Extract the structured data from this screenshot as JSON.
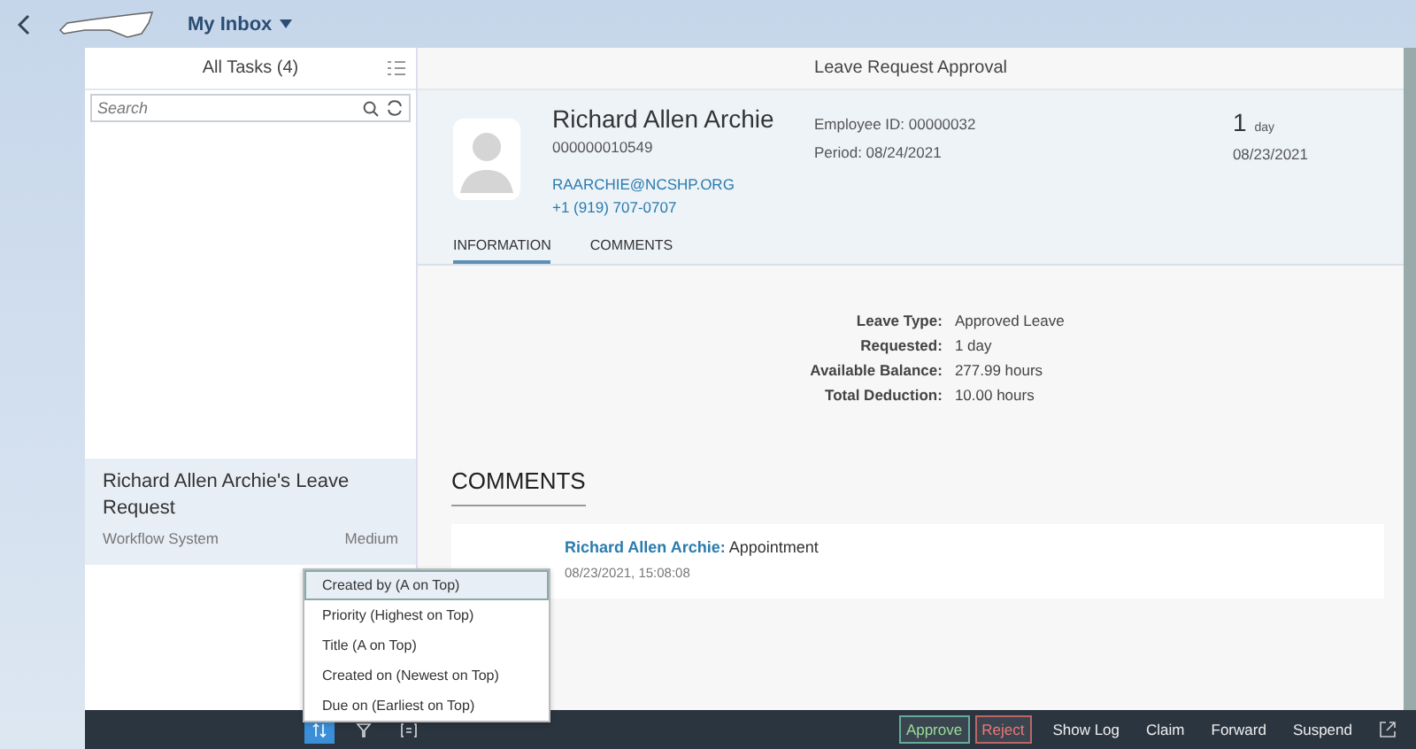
{
  "shell": {
    "title": "My Inbox"
  },
  "master": {
    "title": "All Tasks (4)",
    "search": {
      "placeholder": "Search"
    },
    "tasks": [
      {
        "title": "Richard Allen Archie's Leave Request",
        "source": "Workflow System",
        "priority": "Medium",
        "selected": true
      }
    ]
  },
  "detail": {
    "title": "Leave Request Approval",
    "name": "Richard Allen Archie",
    "number": "000000010549",
    "email": "RAARCHIE@NCSHP.ORG",
    "phone": "+1 (919) 707-0707",
    "employee_id": "Employee ID: 00000032",
    "period": "Period: 08/24/2021",
    "duration": "1",
    "duration_unit": "day",
    "date": "08/23/2021",
    "tabs": [
      {
        "label": "INFORMATION",
        "selected": true
      },
      {
        "label": "COMMENTS",
        "selected": false
      }
    ],
    "fields": [
      {
        "label": "Leave Type:",
        "value": "Approved Leave"
      },
      {
        "label": "Requested:",
        "value": "1 day"
      },
      {
        "label": "Available Balance:",
        "value": "277.99 hours"
      },
      {
        "label": "Total Deduction:",
        "value": "10.00 hours"
      }
    ],
    "comments_heading": "COMMENTS",
    "comments": [
      {
        "author": "Richard Allen Archie:",
        "text": "Appointment",
        "time": "08/23/2021, 15:08:08"
      }
    ]
  },
  "sort_menu": [
    {
      "label": "Created by (A on Top)",
      "selected": true
    },
    {
      "label": "Priority (Highest on Top)",
      "selected": false
    },
    {
      "label": "Title (A on Top)",
      "selected": false
    },
    {
      "label": "Created on (Newest on Top)",
      "selected": false
    },
    {
      "label": "Due on (Earliest on Top)",
      "selected": false
    }
  ],
  "footer": {
    "actions": [
      {
        "label": "Approve",
        "kind": "accept"
      },
      {
        "label": "Reject",
        "kind": "reject"
      },
      {
        "label": "Show Log",
        "kind": "plain"
      },
      {
        "label": "Claim",
        "kind": "plain"
      },
      {
        "label": "Forward",
        "kind": "plain"
      },
      {
        "label": "Suspend",
        "kind": "plain"
      }
    ]
  }
}
